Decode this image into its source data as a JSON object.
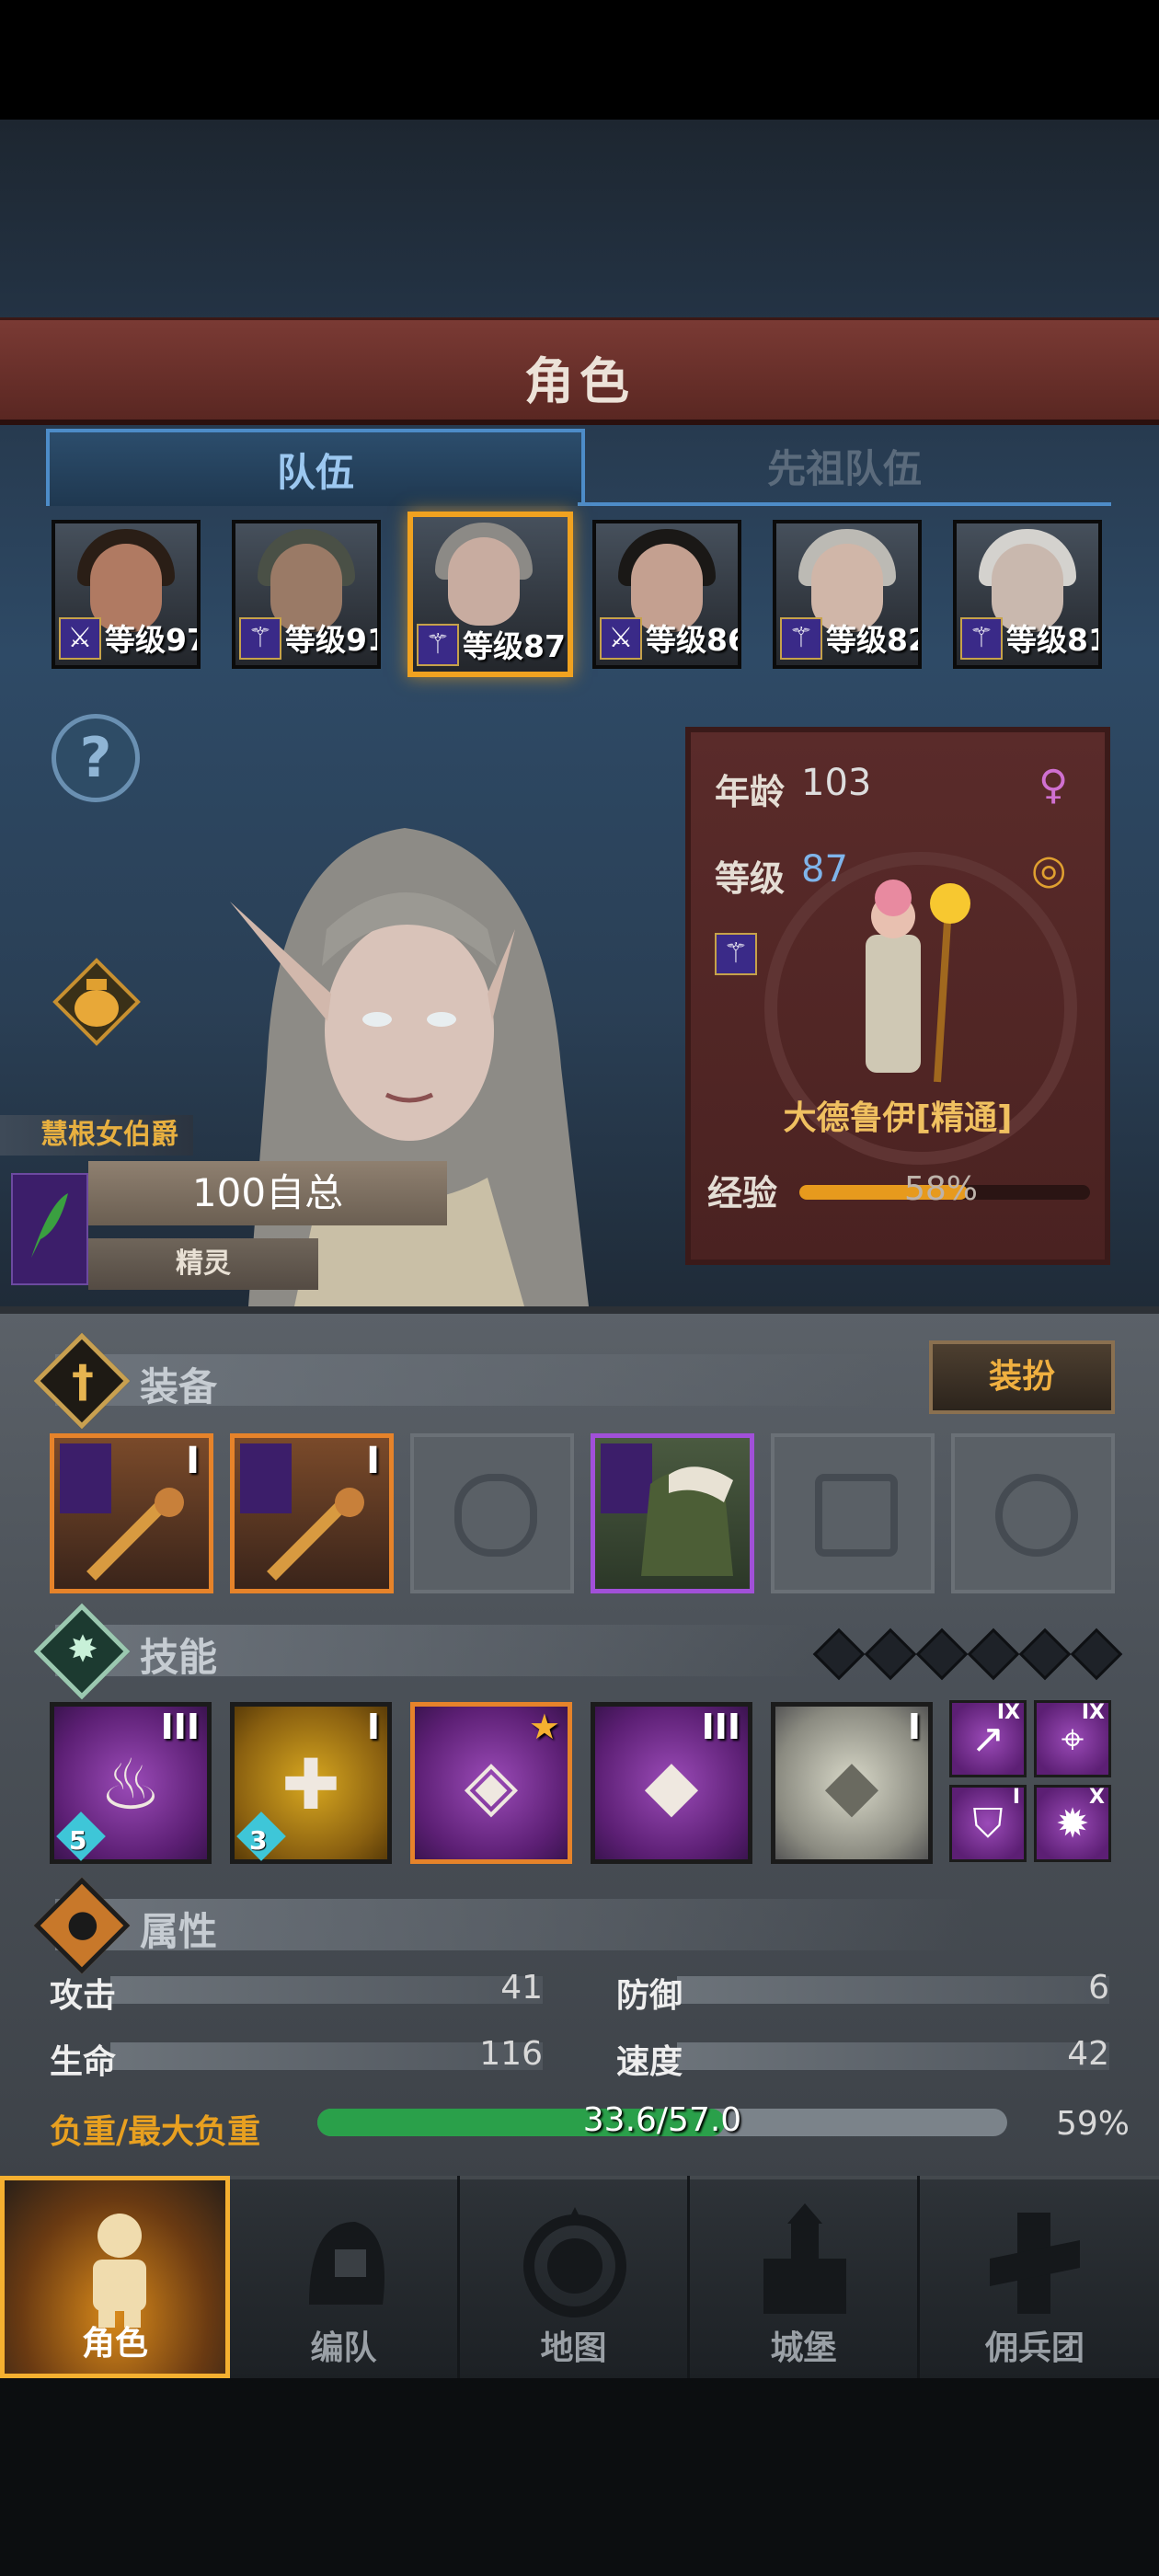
{
  "header": {
    "title": "角色"
  },
  "tabs": [
    {
      "label": "队伍"
    },
    {
      "label": "先祖队伍"
    }
  ],
  "party": [
    {
      "level": "等级97"
    },
    {
      "level": "等级91"
    },
    {
      "level": "等级87"
    },
    {
      "level": "等级86"
    },
    {
      "level": "等级82"
    },
    {
      "level": "等级81"
    }
  ],
  "hero": {
    "title": "慧根女伯爵",
    "name": "100自总",
    "race": "精灵"
  },
  "info": {
    "age_label": "年龄",
    "age": "103",
    "level_label": "等级",
    "level": "87",
    "class_name": "大德鲁伊[精通]",
    "exp_label": "经验",
    "exp_pct": "58%",
    "exp_fraction": 0.58
  },
  "equipment": {
    "title": "装备",
    "outfit_button": "装扮",
    "slots": [
      {
        "tier": "I"
      },
      {
        "tier": "I"
      },
      {
        "tier": ""
      },
      {
        "tier": ""
      },
      {
        "tier": ""
      },
      {
        "tier": ""
      }
    ]
  },
  "skills": {
    "title": "技能",
    "items": [
      {
        "tier": "III",
        "gem": "5"
      },
      {
        "tier": "I",
        "gem": "3"
      },
      {
        "tier": "★",
        "gem": ""
      },
      {
        "tier": "III",
        "gem": ""
      },
      {
        "tier": "I",
        "gem": ""
      }
    ],
    "minis": [
      {
        "tier": "IX"
      },
      {
        "tier": "IX"
      },
      {
        "tier": "I"
      },
      {
        "tier": "X"
      }
    ]
  },
  "attributes": {
    "title": "属性",
    "attack_label": "攻击",
    "attack": "41",
    "defense_label": "防御",
    "defense": "6",
    "hp_label": "生命",
    "hp": "116",
    "speed_label": "速度",
    "speed": "42",
    "load_label": "负重/最大负重",
    "load_text": "33.6/57.0",
    "load_pct": "59%",
    "load_fraction": 0.59
  },
  "nav": [
    {
      "label": "角色"
    },
    {
      "label": "编队"
    },
    {
      "label": "地图"
    },
    {
      "label": "城堡"
    },
    {
      "label": "佣兵团"
    }
  ],
  "colors": {
    "accent": "#e6832a",
    "tab_active": "#4d8cc8",
    "load_fill": "#2aa04a"
  }
}
